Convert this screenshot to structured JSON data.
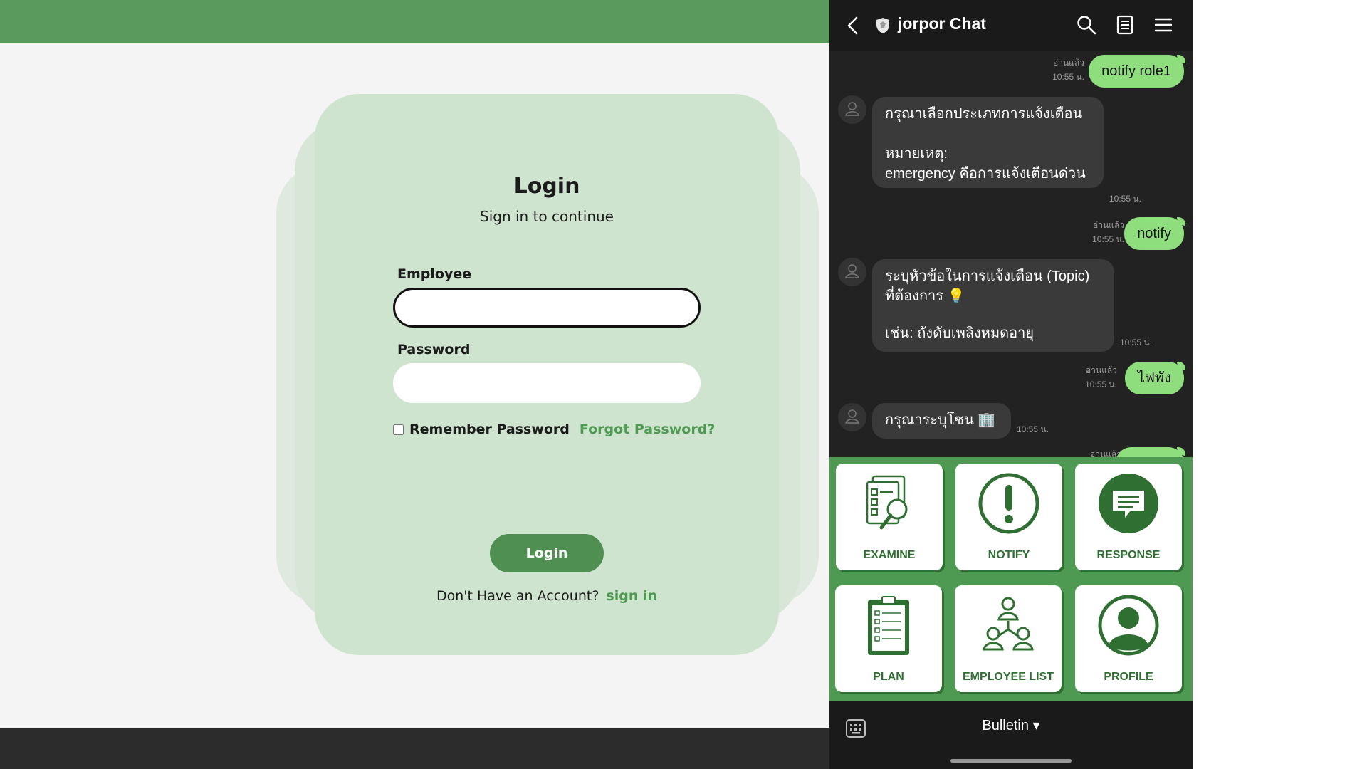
{
  "login": {
    "title": "Login",
    "subtitle": "Sign in to continue",
    "employee_label": "Employee",
    "employee_value": "",
    "password_label": "Password",
    "password_value": "",
    "remember_label": "Remember Password",
    "forgot_label": "Forgot Password?",
    "login_button": "Login",
    "account_prompt": "Don't Have an Account?",
    "signin_link": "sign in"
  },
  "chat": {
    "title": "jorpor Chat",
    "messages": [
      {
        "from": "me",
        "text": "notify role1",
        "read": "อ่านแล้ว",
        "time": "10:55 น."
      },
      {
        "from": "bot",
        "lines": [
          "กรุณาเลือกประเภทการแจ้งเตือน",
          "",
          "หมายเหตุ:",
          "emergency คือการแจ้งเตือนด่วน"
        ],
        "time": "10:55 น."
      },
      {
        "from": "me",
        "text": "notify",
        "read": "อ่านแล้ว",
        "time": "10:55 น."
      },
      {
        "from": "bot",
        "lines": [
          "ระบุหัวข้อในการแจ้งเตือน (Topic)",
          "ที่ต้องการ 💡",
          "",
          "เช่น: ถังดับเพลิงหมดอายุ"
        ],
        "time": "10:55 น."
      },
      {
        "from": "me",
        "text": "ไฟพัง",
        "read": "อ่านแล้ว",
        "time": "10:55 น."
      },
      {
        "from": "bot",
        "lines": [
          "กรุณาระบุโซน 🏢"
        ],
        "time": "10:55 น."
      },
      {
        "from": "me",
        "text": "",
        "read": "อ่านแล้ว",
        "time": ""
      }
    ],
    "menu": [
      {
        "label": "EXAMINE",
        "icon": "examine-icon"
      },
      {
        "label": "NOTIFY",
        "icon": "notify-icon"
      },
      {
        "label": "RESPONSE",
        "icon": "response-icon"
      },
      {
        "label": "PLAN",
        "icon": "plan-icon"
      },
      {
        "label": "EMPLOYEE LIST",
        "icon": "employee-list-icon"
      },
      {
        "label": "PROFILE",
        "icon": "profile-icon"
      }
    ],
    "footer_label": "Bulletin ▾",
    "accent": "#4f9a52",
    "bubble_out": "#8fde7d"
  }
}
